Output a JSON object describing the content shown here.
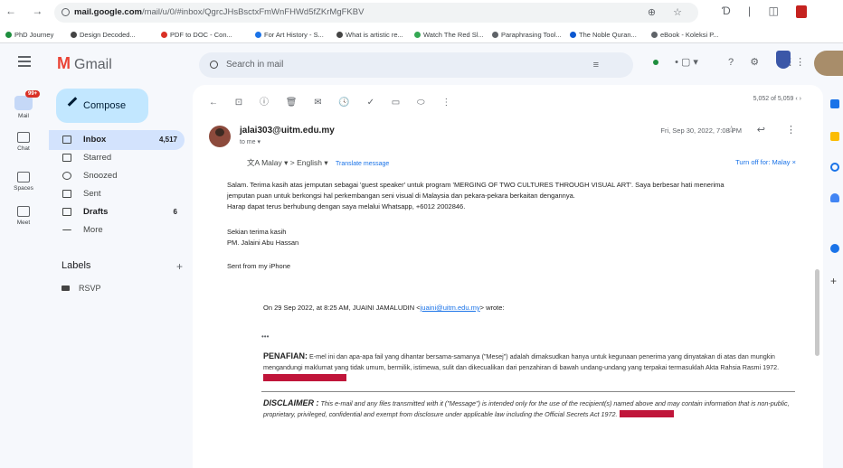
{
  "browser": {
    "nav": "← → C",
    "url_host": "mail.google.com",
    "url_path": "/mail/u/0/#inbox/QgrcJHsBsctxFmWnFHWd5fZKrMgFKBV",
    "url_actions": "⊕ ☆",
    "actions": "Ɗ | ◫",
    "bookmarks": [
      "PhD Journey",
      "Design Decoded...",
      "PDF to DOC - Con...",
      "For Art History - S...",
      "What is artistic re...",
      "Watch The Red Sl...",
      "Paraphrasing Tool...",
      "The Noble Quran...",
      "eBook - Koleksi P..."
    ]
  },
  "gmail": {
    "logo_text": "Gmail",
    "search_placeholder": "Search in mail",
    "filter_icon": "≡",
    "help_icon": "?",
    "settings_icon": "⚙",
    "apps_icon": "⋮⋮⋮",
    "status": "• ▢ ▾"
  },
  "rail": {
    "mail": "Mail",
    "mail_badge": "99+",
    "chat": "Chat",
    "spaces": "Spaces",
    "meet": "Meet"
  },
  "sidebar": {
    "compose": "Compose",
    "items": [
      {
        "label": "Inbox",
        "count": "4,517"
      },
      {
        "label": "Starred",
        "count": ""
      },
      {
        "label": "Snoozed",
        "count": ""
      },
      {
        "label": "Sent",
        "count": ""
      },
      {
        "label": "Drafts",
        "count": "6"
      },
      {
        "label": "More",
        "count": ""
      }
    ],
    "labels_title": "Labels",
    "labels_add": "+",
    "labels": [
      "RSVP"
    ]
  },
  "message": {
    "toolbar_icons": [
      "←",
      "⊡",
      "ⓘ",
      "🗑",
      "✉",
      "🕓",
      "✓",
      "▭",
      "⬭",
      "⋮"
    ],
    "pager": "5,052 of 5,059   ‹   ›",
    "sender": "jalai303@uitm.edu.my",
    "to": "to me ▾",
    "date": "Fri, Sep 30, 2022, 7:08 PM",
    "actions": "☆ ↩ ⋮",
    "translate_from": "Malay ▾",
    "translate_arrow": ">",
    "translate_to": "English ▾",
    "translate_link": "Translate message",
    "turn_off": "Turn off for: Malay ×",
    "body": [
      "Salam. Terima kasih atas jemputan sebagai 'guest speaker' untuk program 'MERGING OF TWO CULTURES THROUGH VISUAL ART'. Saya berbesar hati menerima",
      "jemputan puan untuk berkongsi hal perkembangan seni visual di Malaysia dan pekara-pekara berkaitan dengannya.",
      "Harap dapat terus berhubung dengan saya melalui Whatsapp, +6012 2002846.",
      "Sekian terima kasih",
      "PM. Jalaini Abu Hassan",
      "Sent from my iPhone"
    ],
    "quote_prefix": "On 29 Sep 2022, at 8:25 AM, JUAINI JAMALUDIN <",
    "quote_email": "juaini@uitm.edu.my",
    "quote_suffix": "> wrote:",
    "ellipsis": "•••",
    "penafian_title": "PENAFIAN:",
    "penafian_text": " E-mel ini dan apa-apa fail yang dihantar bersama-samanya (\"Mesej\") adalah dimaksudkan hanya untuk kegunaan penerima yang dinyatakan di atas dan mungkin mengandungi maklumat yang tidak umum, bermilik, istimewa, sulit dan dikecualikan dari penzahiran di bawah undang-undang yang terpakai termasuklah Akta Rahsia Rasmi 1972.",
    "disclaimer_title": "DISCLAIMER :",
    "disclaimer_text": " This e-mail and any files transmitted with it (\"Message\") is intended only for the use of the recipient(s) named above and may contain information that is non-public, proprietary, privileged, confidential and exempt from disclosure under applicable law including the Official Secrets Act 1972."
  },
  "colors": {
    "accent": "#0b57d0",
    "compose": "#c2e7ff",
    "inbox_selected": "#d3e3fd",
    "redaction": "#c0153a"
  }
}
